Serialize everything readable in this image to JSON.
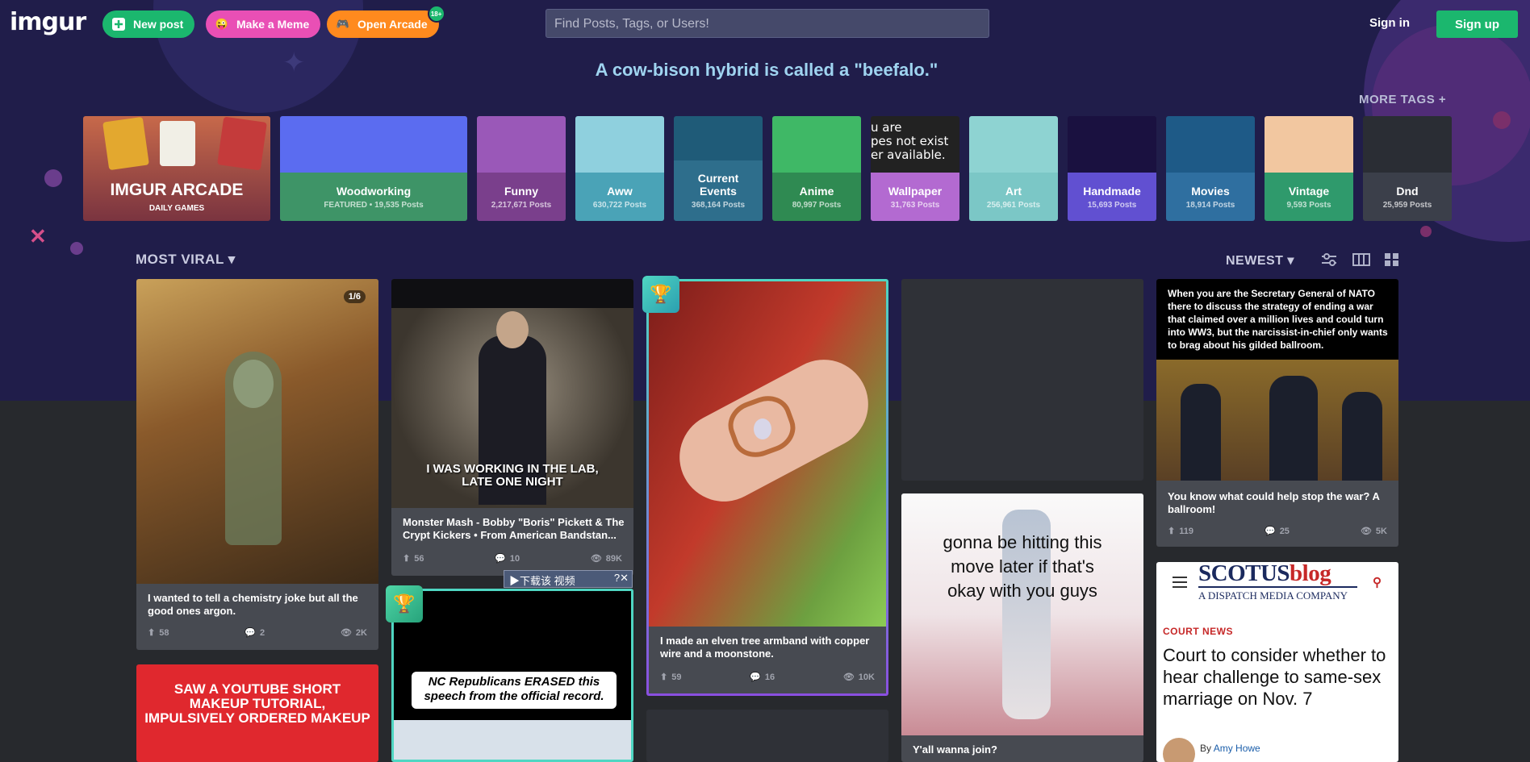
{
  "header": {
    "logo": "imgur",
    "new_post": "New post",
    "make_meme": "Make a Meme",
    "open_arcade": "Open Arcade",
    "arcade_badge": "18+",
    "search_placeholder": "Find Posts, Tags, or Users!",
    "sign_in": "Sign in",
    "sign_up": "Sign up"
  },
  "fact": "A cow-bison hybrid is called a \"beefalo.\"",
  "more_tags": "MORE TAGS +",
  "arcade": {
    "title": "IMGUR ARCADE",
    "subtitle": "DAILY GAMES"
  },
  "tags": [
    {
      "name": "Woodworking",
      "count": "FEATURED • 19,535 Posts",
      "color": "#3e9467",
      "img": "#5b6cf0"
    },
    {
      "name": "Funny",
      "count": "2,217,671 Posts",
      "color": "#7a3f8c",
      "img": "#9a58b8"
    },
    {
      "name": "Aww",
      "count": "630,722 Posts",
      "color": "#4aa3b7",
      "img": "#8fd0de"
    },
    {
      "name": "Current Events",
      "count": "368,164 Posts",
      "color": "#2e6e8c",
      "img": "#1f5b78"
    },
    {
      "name": "Anime",
      "count": "80,997 Posts",
      "color": "#2f8a52",
      "img": "#3fb866"
    },
    {
      "name": "Wallpaper",
      "count": "31,763 Posts",
      "color": "#b36ad1",
      "img": "#222"
    },
    {
      "name": "Art",
      "count": "256,961 Posts",
      "color": "#7bc7c6",
      "img": "#8ed3d2"
    },
    {
      "name": "Handmade",
      "count": "15,693 Posts",
      "color": "#6150d1",
      "img": "#1a1140"
    },
    {
      "name": "Movies",
      "count": "18,914 Posts",
      "color": "#2f6fa0",
      "img": "#1e5a87"
    },
    {
      "name": "Vintage",
      "count": "9,593 Posts",
      "color": "#2f9a6c",
      "img": "#f2c7a0"
    },
    {
      "name": "Dnd",
      "count": "25,959 Posts",
      "color": "#3b3f4a",
      "img": "#2a2d34"
    }
  ],
  "wallpaper_text": "u are\npes not exist\ner available.",
  "feed": {
    "sort": "MOST VIRAL",
    "order": "NEWEST"
  },
  "posts": [
    {
      "title": "I wanted to tell a chemistry joke but all the good ones argon.",
      "up": "58",
      "comments": "2",
      "views": "2K",
      "badge": "1/6"
    },
    {
      "title": "Monster Mash - Bobby \"Boris\" Pickett & The Crypt Kickers  •  From American Bandstan...",
      "up": "56",
      "comments": "10",
      "views": "89K",
      "caption": "I WAS WORKING IN THE LAB, LATE ONE NIGHT"
    },
    {
      "title": "I made an elven tree armband with copper wire and a moonstone.",
      "up": "59",
      "comments": "16",
      "views": "10K"
    },
    {
      "title": "Y'all wanna join?",
      "caption": "gonna be hitting this move later if that's okay with you guys"
    },
    {
      "header_text": "When you are the Secretary General of NATO there to discuss the strategy of ending a war that claimed over a million lives and could turn into WW3, but the narcissist-in-chief only wants to brag about his gilded ballroom.",
      "title": "You know what could help stop the war? A ballroom!",
      "up": "119",
      "comments": "25",
      "views": "5K"
    },
    {
      "caption": "SAW A YOUTUBE SHORT MAKEUP TUTORIAL, IMPULSIVELY ORDERED MAKEUP"
    },
    {
      "caption": "NC Republicans ERASED this speech from the official record.",
      "overlay": "▶下载该 视频"
    },
    {
      "brand1": "SCOTUS",
      "brand2": "blog",
      "tagline": "A DISPATCH MEDIA COMPANY",
      "section": "COURT NEWS",
      "headline": "Court to consider whether to hear challenge to same-sex marriage on Nov. 7",
      "byline_prefix": "By",
      "author": "Amy Howe"
    }
  ]
}
